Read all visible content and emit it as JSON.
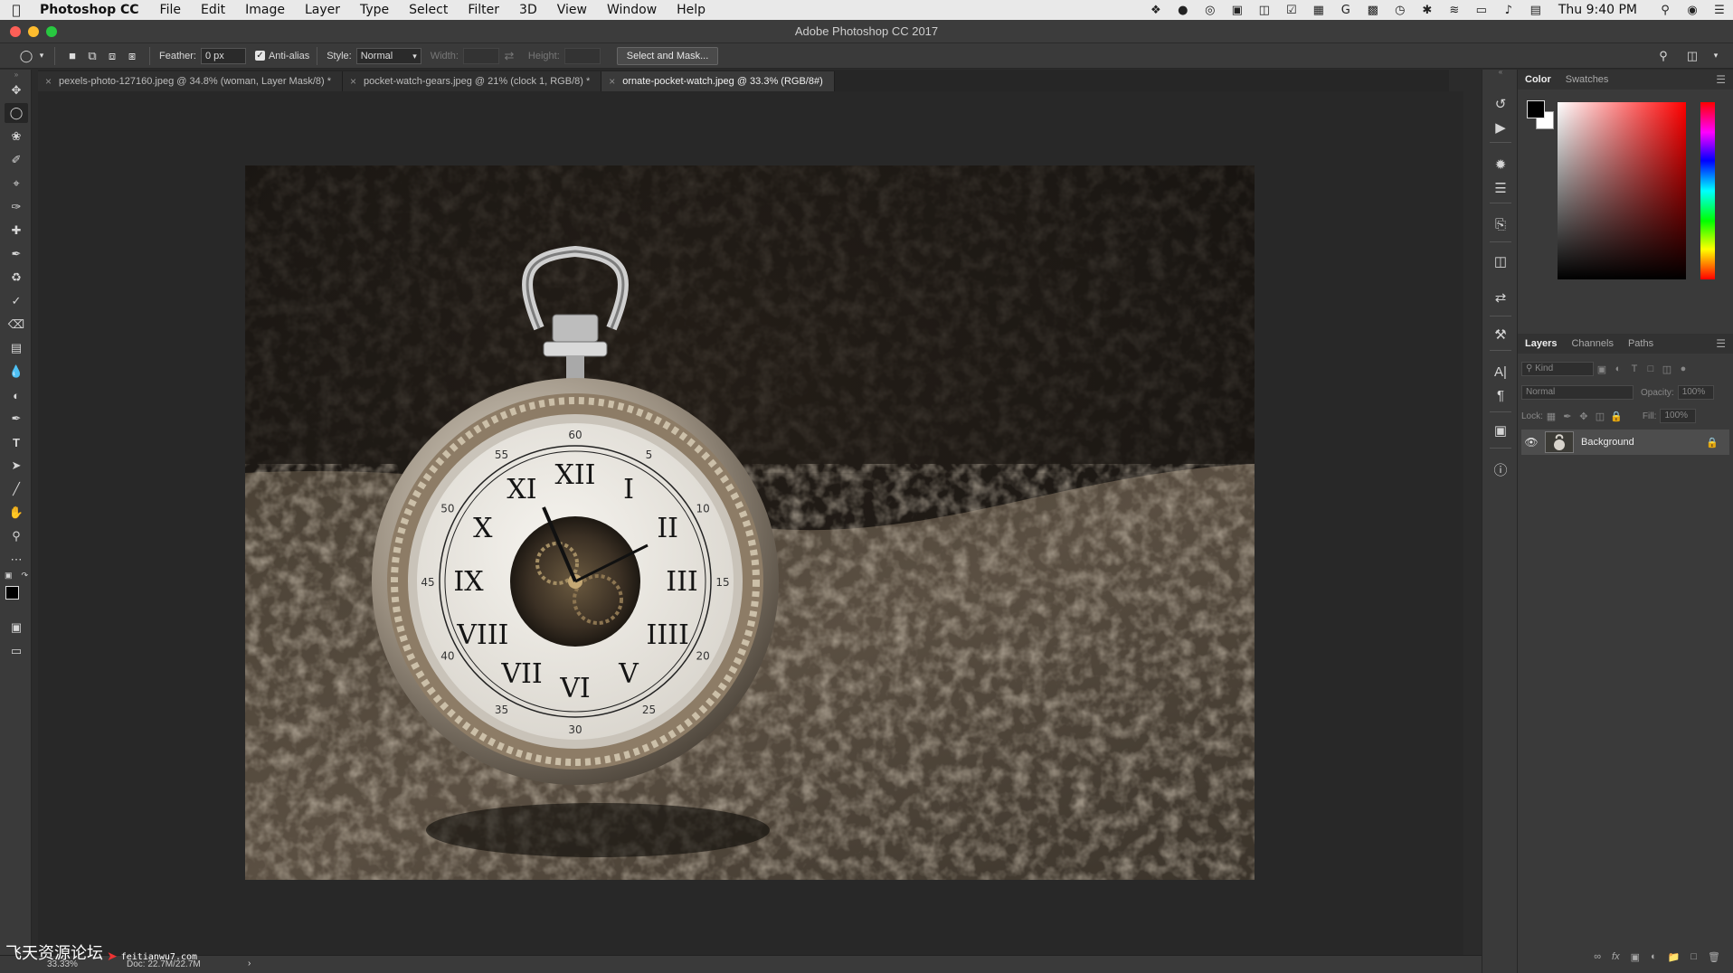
{
  "menubar": {
    "app_name": "Photoshop CC",
    "items": [
      "File",
      "Edit",
      "Image",
      "Layer",
      "Type",
      "Select",
      "Filter",
      "3D",
      "View",
      "Window",
      "Help"
    ],
    "clock": "Thu 9:40 PM"
  },
  "window": {
    "title": "Adobe Photoshop CC 2017"
  },
  "options_bar": {
    "feather_label": "Feather:",
    "feather_value": "0 px",
    "anti_alias_label": "Anti-alias",
    "style_label": "Style:",
    "style_value": "Normal",
    "width_label": "Width:",
    "height_label": "Height:",
    "select_mask_label": "Select and Mask..."
  },
  "tabs": [
    {
      "label": "pexels-photo-127160.jpeg @ 34.8% (woman, Layer Mask/8) *"
    },
    {
      "label": "pocket-watch-gears.jpeg @ 21% (clock 1, RGB/8) *"
    },
    {
      "label": "ornate-pocket-watch.jpeg @ 33.3% (RGB/8#)"
    }
  ],
  "active_tab": 2,
  "status": {
    "zoom": "33.33%",
    "doc": "Doc: 22.7M/22.7M"
  },
  "watermark": {
    "cn": "飞天资源论坛",
    "url": "feitianwu7.com"
  },
  "color_panel": {
    "tab_color": "Color",
    "tab_swatches": "Swatches",
    "foreground": "#000000",
    "background": "#ffffff"
  },
  "layers_panel": {
    "tab_layers": "Layers",
    "tab_channels": "Channels",
    "tab_paths": "Paths",
    "kind_placeholder": "Kind",
    "blend_mode": "Normal",
    "opacity_label": "Opacity:",
    "opacity_value": "100%",
    "lock_label": "Lock:",
    "fill_label": "Fill:",
    "fill_value": "100%",
    "layers": [
      {
        "name": "Background",
        "visible": true,
        "locked": true
      }
    ]
  },
  "photo": {
    "clock_numerals": [
      "XII",
      "I",
      "II",
      "III",
      "IIII",
      "V",
      "VI",
      "VII",
      "VIII",
      "IX",
      "X",
      "XI"
    ],
    "minute_labels": [
      "60",
      "5",
      "10",
      "15",
      "20",
      "25",
      "30",
      "35",
      "40",
      "45",
      "50",
      "55"
    ]
  }
}
